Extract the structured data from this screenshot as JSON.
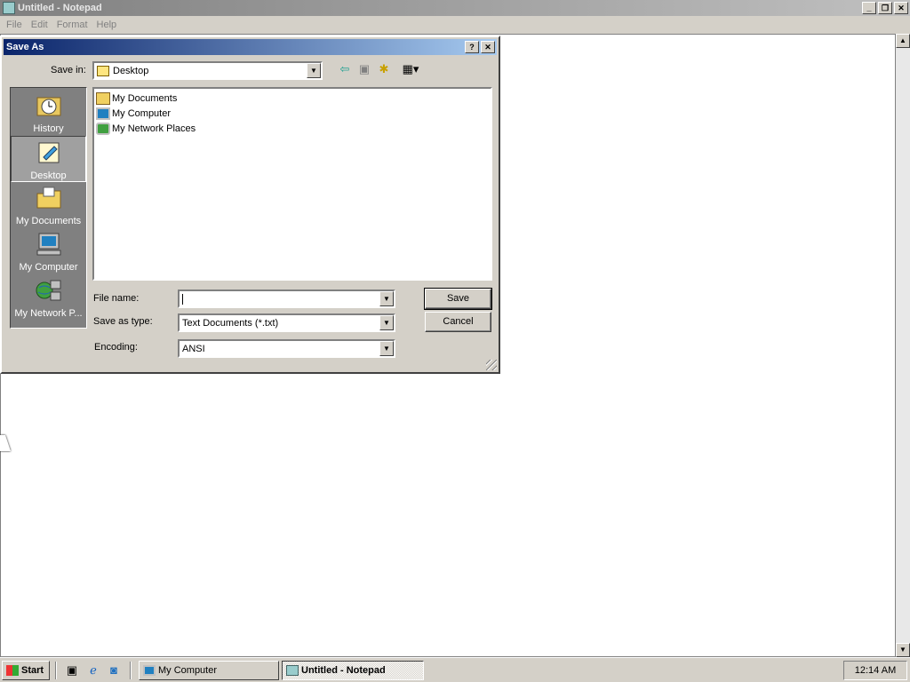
{
  "window": {
    "title": "Untitled - Notepad",
    "menu": [
      "File",
      "Edit",
      "Format",
      "Help"
    ],
    "minimize_glyph": "_",
    "restore_glyph": "❐",
    "close_glyph": "✕"
  },
  "dialog": {
    "title": "Save As",
    "help_glyph": "?",
    "close_glyph": "✕",
    "save_in_label": "Save in:",
    "save_in_value": "Desktop",
    "places": [
      {
        "label": "History",
        "icon": "history-icon"
      },
      {
        "label": "Desktop",
        "icon": "desktop-icon",
        "selected": true
      },
      {
        "label": "My Documents",
        "icon": "my-documents-icon"
      },
      {
        "label": "My Computer",
        "icon": "my-computer-icon"
      },
      {
        "label": "My Network P...",
        "icon": "network-places-icon"
      }
    ],
    "files": [
      {
        "name": "My Documents",
        "icon": "folder-icon"
      },
      {
        "name": "My Computer",
        "icon": "computer-icon"
      },
      {
        "name": "My Network Places",
        "icon": "network-icon"
      }
    ],
    "file_name_label": "File name:",
    "file_name_value": "",
    "save_as_type_label": "Save as type:",
    "save_as_type_value": "Text Documents (*.txt)",
    "encoding_label": "Encoding:",
    "encoding_value": "ANSI",
    "save_button": "Save",
    "cancel_button": "Cancel"
  },
  "taskbar": {
    "start_label": "Start",
    "tasks": [
      {
        "label": "My Computer",
        "active": false
      },
      {
        "label": "Untitled - Notepad",
        "active": true
      }
    ],
    "clock": "12:14 AM"
  }
}
